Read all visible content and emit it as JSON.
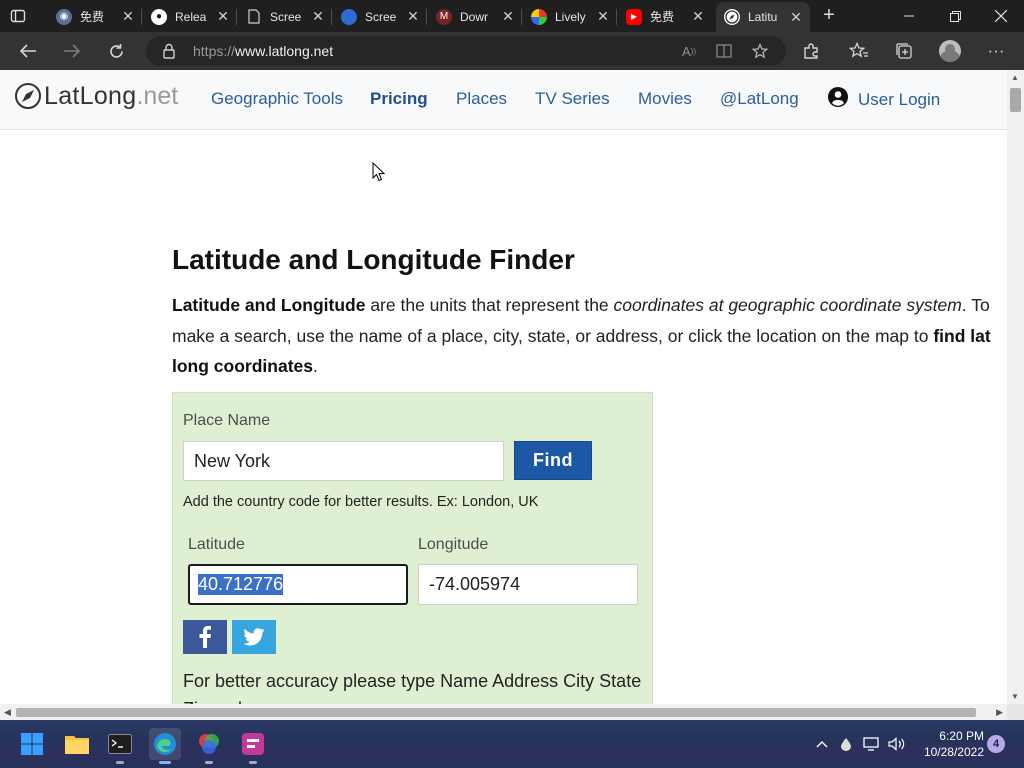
{
  "browser": {
    "tabs": [
      {
        "label": "免费",
        "favicon": "globe-icon",
        "color": "#6d7fa6",
        "active": false
      },
      {
        "label": "Relea",
        "favicon": "github-icon",
        "color": "#ffffff",
        "active": false
      },
      {
        "label": "Scree",
        "favicon": "document-icon",
        "color": "#9a9a9a",
        "active": false
      },
      {
        "label": "Scree",
        "favicon": "edge-shot-icon",
        "color": "#3b7be0",
        "active": false
      },
      {
        "label": "Dowr",
        "favicon": "m-icon",
        "color": "#c23a3a",
        "active": false
      },
      {
        "label": "Lively",
        "favicon": "lively-icon",
        "color": "#e6b400",
        "active": false
      },
      {
        "label": "免费",
        "favicon": "youtube-icon",
        "color": "#ff0000",
        "active": false
      },
      {
        "label": "Latitu",
        "favicon": "compass-icon",
        "color": "#ffffff",
        "active": true
      }
    ],
    "url_scheme": "https://",
    "url_host": "www.latlong.net"
  },
  "site": {
    "logo_name": "LatLong",
    "logo_tld": ".net",
    "nav": [
      {
        "label": "Geographic Tools",
        "bold": false
      },
      {
        "label": "Pricing",
        "bold": true
      },
      {
        "label": "Places",
        "bold": false
      },
      {
        "label": "TV Series",
        "bold": false
      },
      {
        "label": "Movies",
        "bold": false
      },
      {
        "label": "@LatLong",
        "bold": false
      }
    ],
    "user_login": "User Login"
  },
  "main": {
    "title": "Latitude and Longitude Finder",
    "intro": {
      "bold1": "Latitude and Longitude",
      "text1": " are the units that represent the ",
      "italic1": "coordinates at geographic coordinate system",
      "text2": ". To make a search, use the name of a place, city, state, or address, or click the location on the map to ",
      "bold2": "find lat long coordinates",
      "text3": "."
    },
    "finder": {
      "place_label": "Place Name",
      "place_value": "New York",
      "find_button": "Find",
      "hint": "Add the country code for better results. Ex: London, UK",
      "lat_label": "Latitude",
      "lat_value": "40.712776",
      "lng_label": "Longitude",
      "lng_value": "-74.005974",
      "accuracy": "For better accuracy please type Name Address City State Zip code"
    }
  },
  "taskbar": {
    "time": "6:20 PM",
    "date": "10/28/2022",
    "notifications": "4"
  },
  "colors": {
    "accent_blue": "#1c58a6",
    "finder_bg": "#dff0d2",
    "link": "#2a5e9c"
  }
}
